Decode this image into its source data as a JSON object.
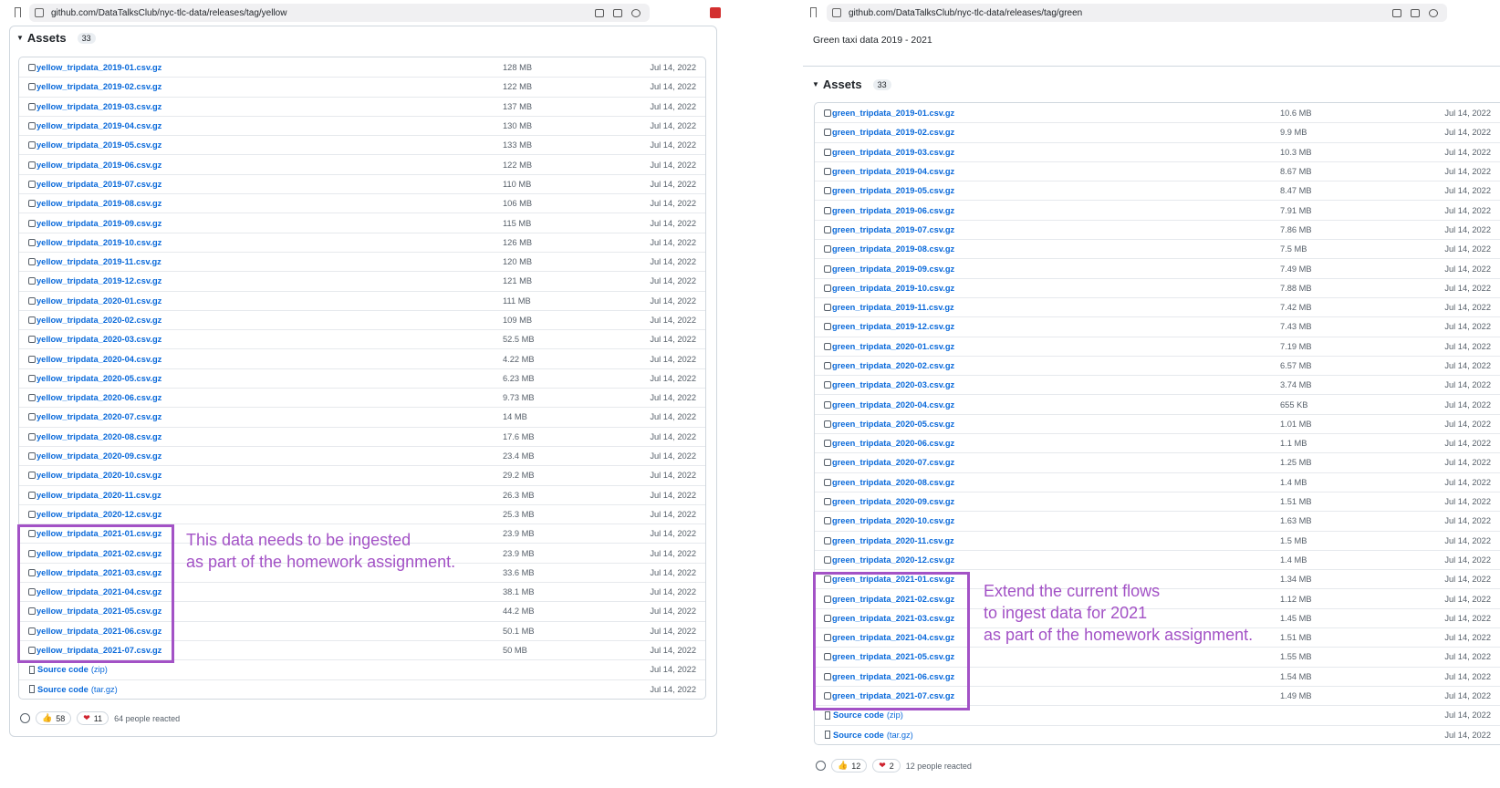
{
  "left": {
    "url": "github.com/DataTalksClub/nyc-tlc-data/releases/tag/yellow",
    "assets_title": "Assets",
    "assets_count": "33",
    "assets": [
      {
        "name": "yellow_tripdata_2019-01.csv.gz",
        "size": "128 MB",
        "date": "Jul 14, 2022"
      },
      {
        "name": "yellow_tripdata_2019-02.csv.gz",
        "size": "122 MB",
        "date": "Jul 14, 2022"
      },
      {
        "name": "yellow_tripdata_2019-03.csv.gz",
        "size": "137 MB",
        "date": "Jul 14, 2022"
      },
      {
        "name": "yellow_tripdata_2019-04.csv.gz",
        "size": "130 MB",
        "date": "Jul 14, 2022"
      },
      {
        "name": "yellow_tripdata_2019-05.csv.gz",
        "size": "133 MB",
        "date": "Jul 14, 2022"
      },
      {
        "name": "yellow_tripdata_2019-06.csv.gz",
        "size": "122 MB",
        "date": "Jul 14, 2022"
      },
      {
        "name": "yellow_tripdata_2019-07.csv.gz",
        "size": "110 MB",
        "date": "Jul 14, 2022"
      },
      {
        "name": "yellow_tripdata_2019-08.csv.gz",
        "size": "106 MB",
        "date": "Jul 14, 2022"
      },
      {
        "name": "yellow_tripdata_2019-09.csv.gz",
        "size": "115 MB",
        "date": "Jul 14, 2022"
      },
      {
        "name": "yellow_tripdata_2019-10.csv.gz",
        "size": "126 MB",
        "date": "Jul 14, 2022"
      },
      {
        "name": "yellow_tripdata_2019-11.csv.gz",
        "size": "120 MB",
        "date": "Jul 14, 2022"
      },
      {
        "name": "yellow_tripdata_2019-12.csv.gz",
        "size": "121 MB",
        "date": "Jul 14, 2022"
      },
      {
        "name": "yellow_tripdata_2020-01.csv.gz",
        "size": "111 MB",
        "date": "Jul 14, 2022"
      },
      {
        "name": "yellow_tripdata_2020-02.csv.gz",
        "size": "109 MB",
        "date": "Jul 14, 2022"
      },
      {
        "name": "yellow_tripdata_2020-03.csv.gz",
        "size": "52.5 MB",
        "date": "Jul 14, 2022"
      },
      {
        "name": "yellow_tripdata_2020-04.csv.gz",
        "size": "4.22 MB",
        "date": "Jul 14, 2022"
      },
      {
        "name": "yellow_tripdata_2020-05.csv.gz",
        "size": "6.23 MB",
        "date": "Jul 14, 2022"
      },
      {
        "name": "yellow_tripdata_2020-06.csv.gz",
        "size": "9.73 MB",
        "date": "Jul 14, 2022"
      },
      {
        "name": "yellow_tripdata_2020-07.csv.gz",
        "size": "14 MB",
        "date": "Jul 14, 2022"
      },
      {
        "name": "yellow_tripdata_2020-08.csv.gz",
        "size": "17.6 MB",
        "date": "Jul 14, 2022"
      },
      {
        "name": "yellow_tripdata_2020-09.csv.gz",
        "size": "23.4 MB",
        "date": "Jul 14, 2022"
      },
      {
        "name": "yellow_tripdata_2020-10.csv.gz",
        "size": "29.2 MB",
        "date": "Jul 14, 2022"
      },
      {
        "name": "yellow_tripdata_2020-11.csv.gz",
        "size": "26.3 MB",
        "date": "Jul 14, 2022"
      },
      {
        "name": "yellow_tripdata_2020-12.csv.gz",
        "size": "25.3 MB",
        "date": "Jul 14, 2022"
      },
      {
        "name": "yellow_tripdata_2021-01.csv.gz",
        "size": "23.9 MB",
        "date": "Jul 14, 2022"
      },
      {
        "name": "yellow_tripdata_2021-02.csv.gz",
        "size": "23.9 MB",
        "date": "Jul 14, 2022"
      },
      {
        "name": "yellow_tripdata_2021-03.csv.gz",
        "size": "33.6 MB",
        "date": "Jul 14, 2022"
      },
      {
        "name": "yellow_tripdata_2021-04.csv.gz",
        "size": "38.1 MB",
        "date": "Jul 14, 2022"
      },
      {
        "name": "yellow_tripdata_2021-05.csv.gz",
        "size": "44.2 MB",
        "date": "Jul 14, 2022"
      },
      {
        "name": "yellow_tripdata_2021-06.csv.gz",
        "size": "50.1 MB",
        "date": "Jul 14, 2022"
      },
      {
        "name": "yellow_tripdata_2021-07.csv.gz",
        "size": "50 MB",
        "date": "Jul 14, 2022"
      }
    ],
    "sources": [
      {
        "label": "Source code",
        "ext": "(zip)",
        "date": "Jul 14, 2022"
      },
      {
        "label": "Source code",
        "ext": "(tar.gz)",
        "date": "Jul 14, 2022"
      }
    ],
    "reactions": {
      "thumbs": "58",
      "hearts": "11",
      "text": "64 people reacted"
    },
    "annotation": [
      "This data needs to be ingested",
      "as part of the homework assignment."
    ]
  },
  "right": {
    "url": "github.com/DataTalksClub/nyc-tlc-data/releases/tag/green",
    "description": "Green taxi data 2019 - 2021",
    "assets_title": "Assets",
    "assets_count": "33",
    "assets": [
      {
        "name": "green_tripdata_2019-01.csv.gz",
        "size": "10.6 MB",
        "date": "Jul 14, 2022"
      },
      {
        "name": "green_tripdata_2019-02.csv.gz",
        "size": "9.9 MB",
        "date": "Jul 14, 2022"
      },
      {
        "name": "green_tripdata_2019-03.csv.gz",
        "size": "10.3 MB",
        "date": "Jul 14, 2022"
      },
      {
        "name": "green_tripdata_2019-04.csv.gz",
        "size": "8.67 MB",
        "date": "Jul 14, 2022"
      },
      {
        "name": "green_tripdata_2019-05.csv.gz",
        "size": "8.47 MB",
        "date": "Jul 14, 2022"
      },
      {
        "name": "green_tripdata_2019-06.csv.gz",
        "size": "7.91 MB",
        "date": "Jul 14, 2022"
      },
      {
        "name": "green_tripdata_2019-07.csv.gz",
        "size": "7.86 MB",
        "date": "Jul 14, 2022"
      },
      {
        "name": "green_tripdata_2019-08.csv.gz",
        "size": "7.5 MB",
        "date": "Jul 14, 2022"
      },
      {
        "name": "green_tripdata_2019-09.csv.gz",
        "size": "7.49 MB",
        "date": "Jul 14, 2022"
      },
      {
        "name": "green_tripdata_2019-10.csv.gz",
        "size": "7.88 MB",
        "date": "Jul 14, 2022"
      },
      {
        "name": "green_tripdata_2019-11.csv.gz",
        "size": "7.42 MB",
        "date": "Jul 14, 2022"
      },
      {
        "name": "green_tripdata_2019-12.csv.gz",
        "size": "7.43 MB",
        "date": "Jul 14, 2022"
      },
      {
        "name": "green_tripdata_2020-01.csv.gz",
        "size": "7.19 MB",
        "date": "Jul 14, 2022"
      },
      {
        "name": "green_tripdata_2020-02.csv.gz",
        "size": "6.57 MB",
        "date": "Jul 14, 2022"
      },
      {
        "name": "green_tripdata_2020-03.csv.gz",
        "size": "3.74 MB",
        "date": "Jul 14, 2022"
      },
      {
        "name": "green_tripdata_2020-04.csv.gz",
        "size": "655 KB",
        "date": "Jul 14, 2022"
      },
      {
        "name": "green_tripdata_2020-05.csv.gz",
        "size": "1.01 MB",
        "date": "Jul 14, 2022"
      },
      {
        "name": "green_tripdata_2020-06.csv.gz",
        "size": "1.1 MB",
        "date": "Jul 14, 2022"
      },
      {
        "name": "green_tripdata_2020-07.csv.gz",
        "size": "1.25 MB",
        "date": "Jul 14, 2022"
      },
      {
        "name": "green_tripdata_2020-08.csv.gz",
        "size": "1.4 MB",
        "date": "Jul 14, 2022"
      },
      {
        "name": "green_tripdata_2020-09.csv.gz",
        "size": "1.51 MB",
        "date": "Jul 14, 2022"
      },
      {
        "name": "green_tripdata_2020-10.csv.gz",
        "size": "1.63 MB",
        "date": "Jul 14, 2022"
      },
      {
        "name": "green_tripdata_2020-11.csv.gz",
        "size": "1.5 MB",
        "date": "Jul 14, 2022"
      },
      {
        "name": "green_tripdata_2020-12.csv.gz",
        "size": "1.4 MB",
        "date": "Jul 14, 2022"
      },
      {
        "name": "green_tripdata_2021-01.csv.gz",
        "size": "1.34 MB",
        "date": "Jul 14, 2022"
      },
      {
        "name": "green_tripdata_2021-02.csv.gz",
        "size": "1.12 MB",
        "date": "Jul 14, 2022"
      },
      {
        "name": "green_tripdata_2021-03.csv.gz",
        "size": "1.45 MB",
        "date": "Jul 14, 2022"
      },
      {
        "name": "green_tripdata_2021-04.csv.gz",
        "size": "1.51 MB",
        "date": "Jul 14, 2022"
      },
      {
        "name": "green_tripdata_2021-05.csv.gz",
        "size": "1.55 MB",
        "date": "Jul 14, 2022"
      },
      {
        "name": "green_tripdata_2021-06.csv.gz",
        "size": "1.54 MB",
        "date": "Jul 14, 2022"
      },
      {
        "name": "green_tripdata_2021-07.csv.gz",
        "size": "1.49 MB",
        "date": "Jul 14, 2022"
      }
    ],
    "sources": [
      {
        "label": "Source code",
        "ext": "(zip)",
        "date": "Jul 14, 2022"
      },
      {
        "label": "Source code",
        "ext": "(tar.gz)",
        "date": "Jul 14, 2022"
      }
    ],
    "reactions": {
      "thumbs": "12",
      "hearts": "2",
      "text": "12 people reacted"
    },
    "annotation": [
      "Extend the current flows",
      "to ingest data for 2021",
      "as part of the homework assignment."
    ]
  },
  "colors": {
    "link": "#0969da",
    "annotation": "#a352c6",
    "muted": "#57606a",
    "border": "#d0d7de"
  },
  "icons": {
    "asset": "package-icon",
    "source": "file-zip-icon",
    "add_reaction": "smiley-icon",
    "url_settings": "tune-icon"
  }
}
